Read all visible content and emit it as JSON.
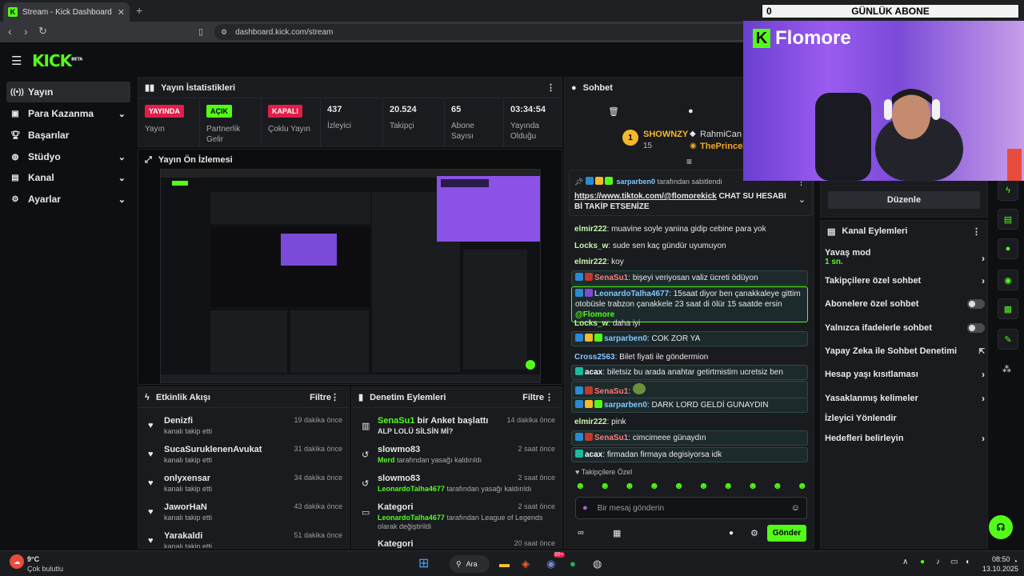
{
  "browser": {
    "tab_title": "Stream - Kick Dashboard",
    "url": "dashboard.kick.com/stream"
  },
  "overlay": {
    "abone_count": "0",
    "abone_label": "GÜNLÜK ABONE",
    "cam_brand": "Flomore"
  },
  "kick": {
    "logo": "KICK",
    "beta": "BETA"
  },
  "sidebar": {
    "items": [
      {
        "label": "Yayın",
        "icon": "broadcast-icon"
      },
      {
        "label": "Para Kazanma",
        "icon": "money-icon"
      },
      {
        "label": "Başarılar",
        "icon": "trophy-icon"
      },
      {
        "label": "Stüdyo",
        "icon": "studio-icon"
      },
      {
        "label": "Kanal",
        "icon": "channel-icon"
      },
      {
        "label": "Ayarlar",
        "icon": "gear-icon"
      }
    ]
  },
  "stats": {
    "title": "Yayın İstatistikleri",
    "cells": [
      {
        "badge": "YAYINDA",
        "label": "Yayın",
        "color": "#e11d48"
      },
      {
        "badge": "AÇIK",
        "label": "Partnerlik Gelir",
        "color": "#53fc18"
      },
      {
        "badge": "KAPALI",
        "label": "Çoklu Yayın",
        "color": "#e11d48"
      },
      {
        "value": "437",
        "label": "İzleyici"
      },
      {
        "value": "20.524",
        "label": "Takipçi"
      },
      {
        "value": "65",
        "label": "Abone Sayısı"
      },
      {
        "value": "03:34:54",
        "label": "Yayında Olduğu"
      }
    ]
  },
  "preview": {
    "title": "Yayın Ön İzlemesi"
  },
  "activity": {
    "title": "Etkinlik Akışı",
    "filter": "Filtre",
    "items": [
      {
        "name": "Denizfi",
        "sub": "kanalı takip etti",
        "time": "19 dakika önce"
      },
      {
        "name": "SucaSuruklenenAvukat",
        "sub": "kanalı takip etti",
        "time": "31 dakika önce"
      },
      {
        "name": "onlyxensar",
        "sub": "kanalı takip etti",
        "time": "34 dakika önce"
      },
      {
        "name": "JaworHaN",
        "sub": "kanalı takip etti",
        "time": "43 dakika önce"
      },
      {
        "name": "Yarakaldi",
        "sub": "kanalı takip etti",
        "time": "51 dakika önce"
      }
    ]
  },
  "moderation": {
    "title": "Denetim Eylemleri",
    "filter": "Filtre",
    "items": [
      {
        "name": "SenaSu1",
        "name_rest": " bir Anket başlattı",
        "sub": "ALP LOLÜ SİLSİN Mİ?",
        "time": "14 dakika önce"
      },
      {
        "name": "slowmo83",
        "sub_user": "Merd",
        "sub": " tarafından yasağı kaldırıldı",
        "time": "2 saat önce"
      },
      {
        "name": "slowmo83",
        "sub_user": "LeonardoTalha4677",
        "sub": " tarafından yasağı kaldırıldı",
        "time": "2 saat önce"
      },
      {
        "name": "Kategori",
        "sub_user": "LeonardoTalha4677",
        "sub": " tarafından League of Legends",
        "sub2": "olarak değiştirildi",
        "time": "2 saat önce"
      },
      {
        "name": "Kategori",
        "time": "20 saat önce"
      }
    ]
  },
  "chat": {
    "title": "Sohbet",
    "top_users": [
      {
        "rank": "1",
        "name": "SHOWNZY",
        "count": "15"
      },
      {
        "name": "RahmiCan"
      },
      {
        "name": "ThePrinceK"
      }
    ],
    "pinned_by": "sarparben0",
    "pinned_suffix": " tarafından sabitlendi",
    "pinned_link": "https://www.tiktok.com/@flomorekick",
    "pinned_text": " CHAT SU HESABI Bİ TAKİP ETSENİZE",
    "messages": [
      {
        "user": "elmir222",
        "color": "#c6f7a6",
        "text": "muavine soyle yanina gidip cebine para yok"
      },
      {
        "user": "Locks_w",
        "color": "#c6f7a6",
        "text": "sude sen kaç gündür uyumuyon"
      },
      {
        "user": "elmir222",
        "color": "#c6f7a6",
        "text": "koy"
      },
      {
        "user": "SenaSu1",
        "color": "#ff7b7b",
        "text": "bişeyi veriyosan valiz ücreti ödüyon"
      },
      {
        "user": "LeonardoTalha4677",
        "color": "#7fc8ff",
        "text": "15saat diyor ben çanakkaleye gittim otobüsle trabzon çanakkele 23 saat di ölür 15 saatde ersin ",
        "mention": "@Flomore"
      },
      {
        "user": "Locks_w",
        "color": "#c6f7a6",
        "text": "daha iyi"
      },
      {
        "user": "sarparben0",
        "color": "#7fc8ff",
        "text": "COK ZOR YA"
      },
      {
        "user": "Cross2563",
        "color": "#7fc8ff",
        "text": "Bilet fiyati ile göndermion"
      },
      {
        "user": "acax",
        "color": "#ffffff",
        "text": "biletsiz bu arada anahtar getirtmistim ucretsiz ben"
      },
      {
        "user": "SenaSu1",
        "color": "#ff7b7b",
        "text": ""
      },
      {
        "user": "sarparben0",
        "color": "#7fc8ff",
        "text": "DARK LORD GELDİ GUNAYDIN"
      },
      {
        "user": "elmir222",
        "color": "#c6f7a6",
        "text": "pink"
      },
      {
        "user": "SenaSu1",
        "color": "#ff7b7b",
        "text": "cimcimeee günaydın"
      },
      {
        "user": "acax",
        "color": "#ffffff",
        "text": "firmadan firmaya degisiyorsa idk"
      }
    ],
    "followers_only": "Takipçilere Özel",
    "input_placeholder": "Bir mesaj gönderin",
    "send": "Gönder"
  },
  "right": {
    "edit_button": "Düzenle",
    "actions_title": "Kanal Eylemleri",
    "slow_mode": "Yavaş mod",
    "slow_value": "1 sn.",
    "items": [
      "Takipçilere özel sohbet",
      "Abonelere özel sohbet",
      "Yalnızca ifadelerle sohbet",
      "Yapay Zeka ile Sohbet Denetimi",
      "Hesap yaşı kısıtlaması",
      "Yasaklanmış kelimeler",
      "İzleyici Yönlendir",
      "Hedefleri belirleyin"
    ]
  },
  "taskbar": {
    "temp": "9°C",
    "weather": "Çok bulutlu",
    "search": "Ara",
    "time": "08:50",
    "date": "13.10.2025",
    "notif": "99+"
  }
}
